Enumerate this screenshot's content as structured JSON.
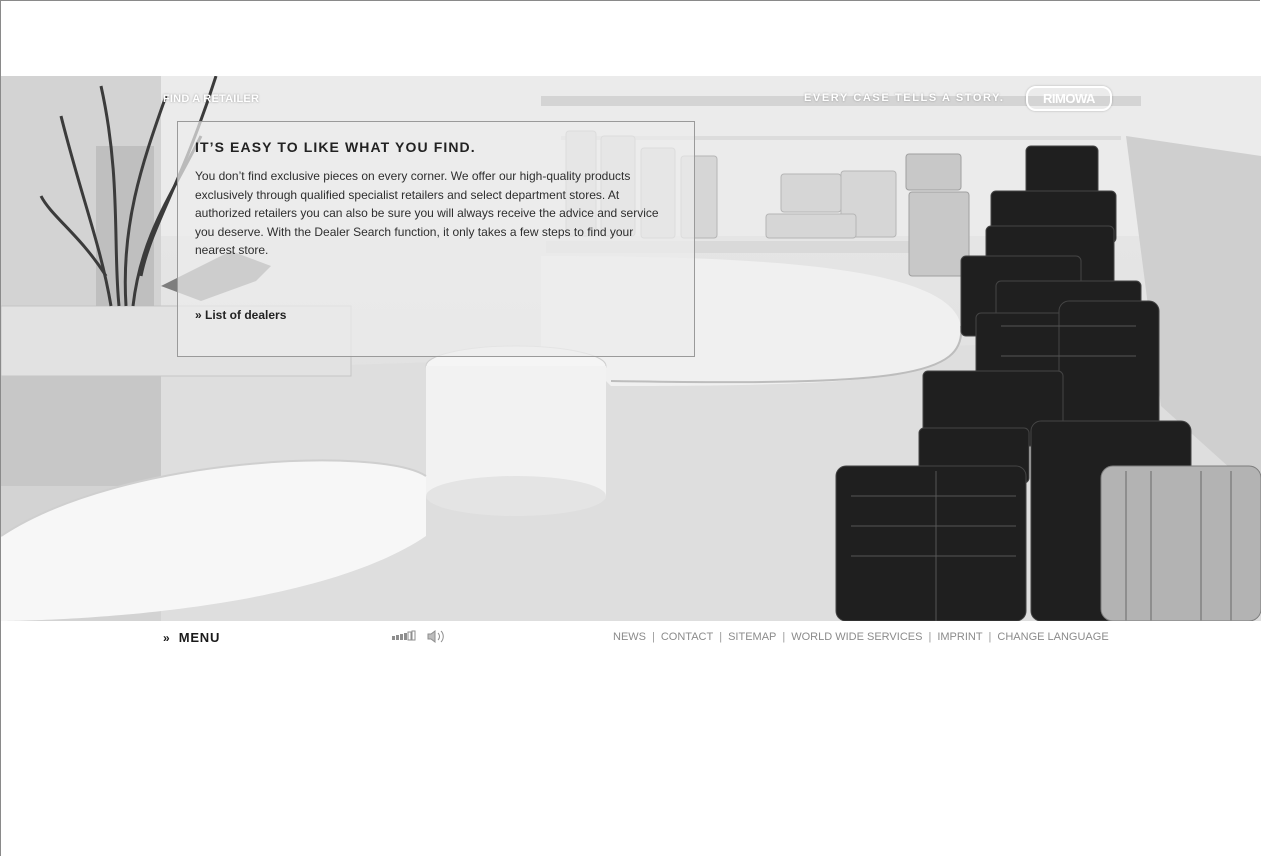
{
  "hero": {
    "section_title": "FIND A RETAILER",
    "tagline": "EVERY CASE TELLS A STORY.",
    "logo": "RIMOWA"
  },
  "panel": {
    "heading": "IT’S EASY TO LIKE WHAT YOU FIND.",
    "body": "You don’t find exclusive pieces on every corner. We offer our high-quality products exclusively through qualified specialist retailers and select department stores. At authorized retailers you can also be sure you will always receive the advice and service you deserve. With the Dealer Search function, it only takes a few steps to find your nearest store.",
    "link": "» List of dealers"
  },
  "footer": {
    "menu_arrow": "»",
    "menu_label": "MENU",
    "volume_icon": "speaker-icon",
    "links": [
      "NEWS",
      "CONTACT",
      "SITEMAP",
      "WORLD WIDE SERVICES",
      "IMPRINT",
      "CHANGE LANGUAGE"
    ],
    "separator": "|"
  }
}
